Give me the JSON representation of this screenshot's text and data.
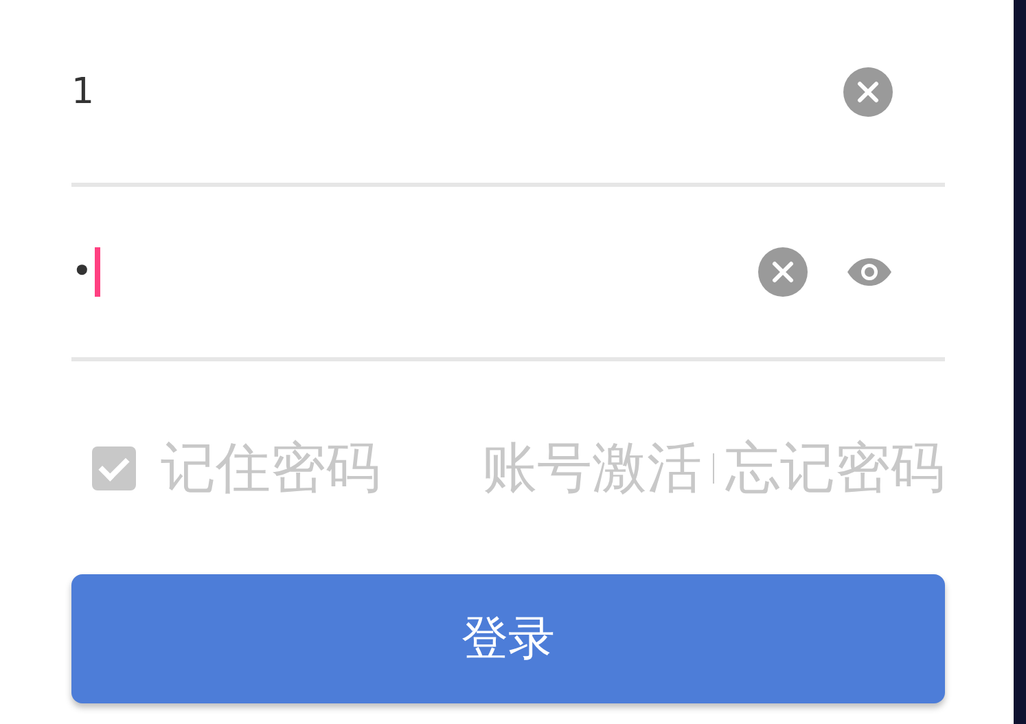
{
  "username": {
    "value": "1"
  },
  "password": {
    "value": "•",
    "focused": true
  },
  "remember": {
    "label": "记住密码",
    "checked": true
  },
  "links": [
    "账号激活",
    "忘记密码"
  ],
  "login_button": {
    "label": "登录"
  }
}
